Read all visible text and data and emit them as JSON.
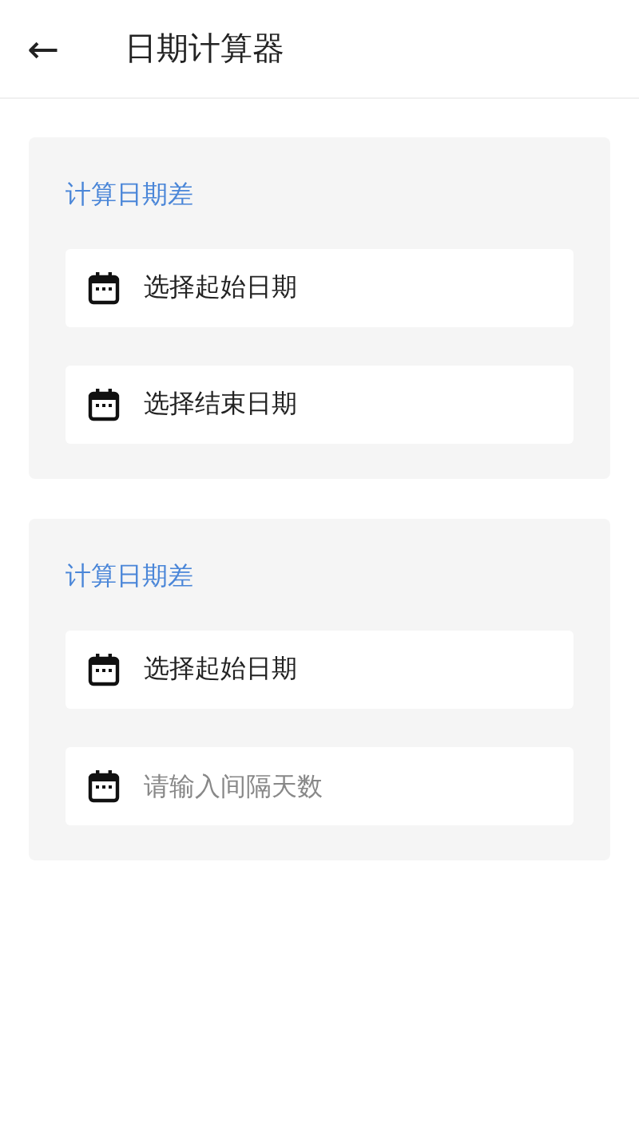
{
  "header": {
    "back": "←",
    "title": "日期计算器"
  },
  "cards": [
    {
      "title": "计算日期差",
      "fields": [
        {
          "kind": "picker",
          "text": "选择起始日期"
        },
        {
          "kind": "picker",
          "text": "选择结束日期"
        }
      ]
    },
    {
      "title": "计算日期差",
      "fields": [
        {
          "kind": "picker",
          "text": "选择起始日期"
        },
        {
          "kind": "input",
          "placeholder": "请输入间隔天数"
        }
      ]
    }
  ]
}
